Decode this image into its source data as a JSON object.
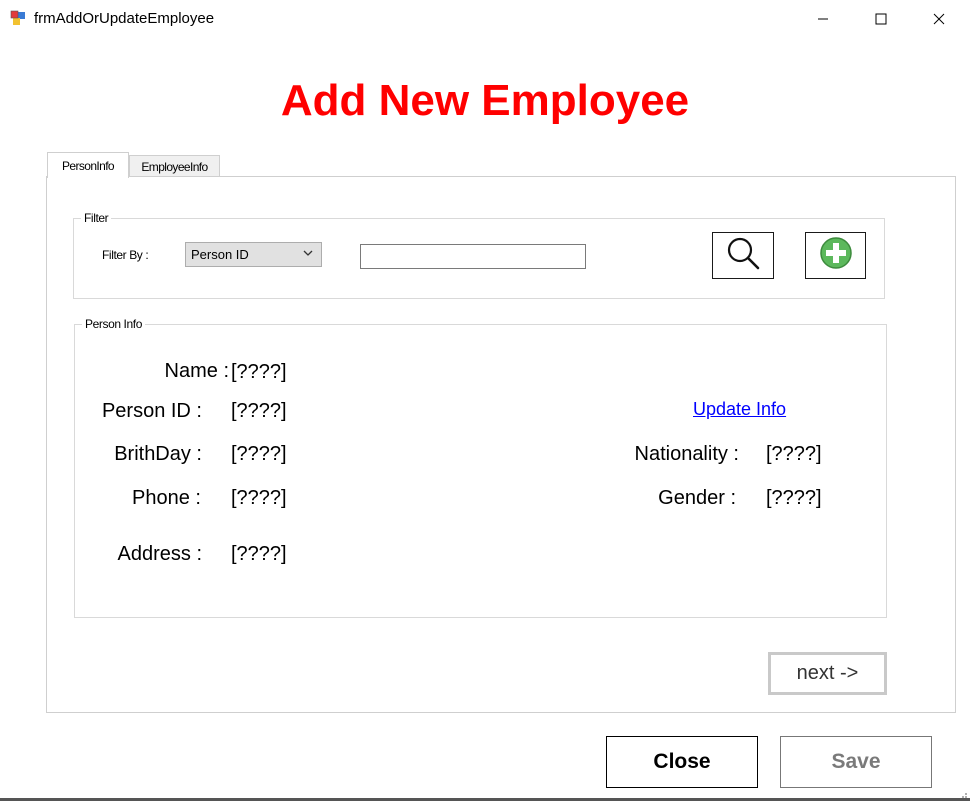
{
  "window": {
    "title": "frmAddOrUpdateEmployee",
    "controls": {
      "minimize": "minimize-icon",
      "maximize": "maximize-icon",
      "close": "close-icon"
    }
  },
  "header": {
    "title": "Add New Employee",
    "title_color": "#ff0000"
  },
  "tabs": [
    {
      "label": "PersonInfo",
      "active": true
    },
    {
      "label": "EmployeeInfo",
      "active": false
    }
  ],
  "filter": {
    "group_label": "Filter",
    "filter_by_label": "Filter By :",
    "selected_option": "Person ID",
    "search_value": "",
    "search_icon": "search-icon",
    "add_icon": "add-person-icon",
    "add_icon_color": "#5cb85c"
  },
  "person_info": {
    "group_label": "Person Info",
    "name_label": "Name  :",
    "name_value": "[????]",
    "person_id_label": "Person ID :",
    "person_id_value": "[????]",
    "birthday_label": "BrithDay :",
    "birthday_value": "[????]",
    "phone_label": "Phone :",
    "phone_value": "[????]",
    "address_label": "Address :",
    "address_value": "[????]",
    "update_link": "Update Info",
    "nationality_label": "Nationality :",
    "nationality_value": "[????]",
    "gender_label": "Gender :",
    "gender_value": "[????]"
  },
  "next_button": "next ->",
  "footer": {
    "close_label": "Close",
    "save_label": "Save",
    "save_enabled": false
  }
}
